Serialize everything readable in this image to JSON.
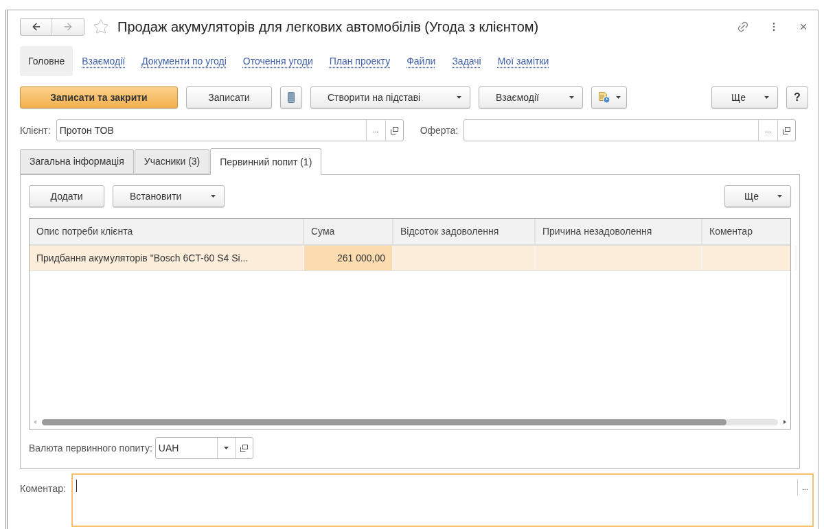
{
  "window": {
    "title": "Продаж акумуляторів для легкових автомобілів (Угода з клієнтом)",
    "favorite": false
  },
  "nav": [
    {
      "label": "Головне",
      "selected": true
    },
    {
      "label": "Взаємодії",
      "selected": false
    },
    {
      "label": "Документи по угоді",
      "selected": false
    },
    {
      "label": "Оточення угоди",
      "selected": false
    },
    {
      "label": "План проекту",
      "selected": false
    },
    {
      "label": "Файли",
      "selected": false
    },
    {
      "label": "Задачі",
      "selected": false
    },
    {
      "label": "Мої замітки",
      "selected": false
    }
  ],
  "toolbar": [
    {
      "kind": "primary",
      "label": "Записати та закрити"
    },
    {
      "kind": "default",
      "label": "Записати"
    },
    {
      "kind": "stack-icon"
    },
    {
      "kind": "dropdown",
      "label": "Створити на підставі"
    },
    {
      "kind": "dropdown",
      "label": "Взаємодії"
    },
    {
      "kind": "report-icon"
    },
    {
      "kind": "more",
      "label": "Ще"
    },
    {
      "kind": "help",
      "label": "?"
    }
  ],
  "client": {
    "label": "Клієнт:",
    "value": "Протон ТОВ",
    "select_glyph": "..."
  },
  "offer": {
    "label": "Оферта:",
    "select_glyph": "..."
  },
  "tabs": [
    {
      "label": "Загальна інформація",
      "selected": false
    },
    {
      "label": "Учасники (3)",
      "selected": false
    },
    {
      "label": "Первинний попит (1)",
      "selected": true
    }
  ],
  "panel_buttons": [
    {
      "kind": "default",
      "label": "Додати"
    },
    {
      "kind": "dropdown",
      "label": "Встановити"
    },
    {
      "kind": "more",
      "label": "Ще"
    }
  ],
  "table": {
    "columns": [
      "Опис потреби клієнта",
      "Сума",
      "Відсоток задоволення",
      "Причина незадоволення",
      "Коментар"
    ],
    "rows": [
      {
        "selected": true,
        "cells": [
          {
            "text": "Придбання акумуляторів \"Bosch 6CT-60 S4 Si...",
            "current": false
          },
          {
            "text": "261 000,00",
            "current": true
          },
          {
            "current": false
          },
          {
            "current": false
          },
          {
            "current": false
          }
        ]
      }
    ]
  },
  "currency": {
    "label": "Валюта первинного попиту:",
    "value": "UAH"
  },
  "comment": {
    "label": "Коментар:",
    "focused": true,
    "select_glyph": "..."
  }
}
